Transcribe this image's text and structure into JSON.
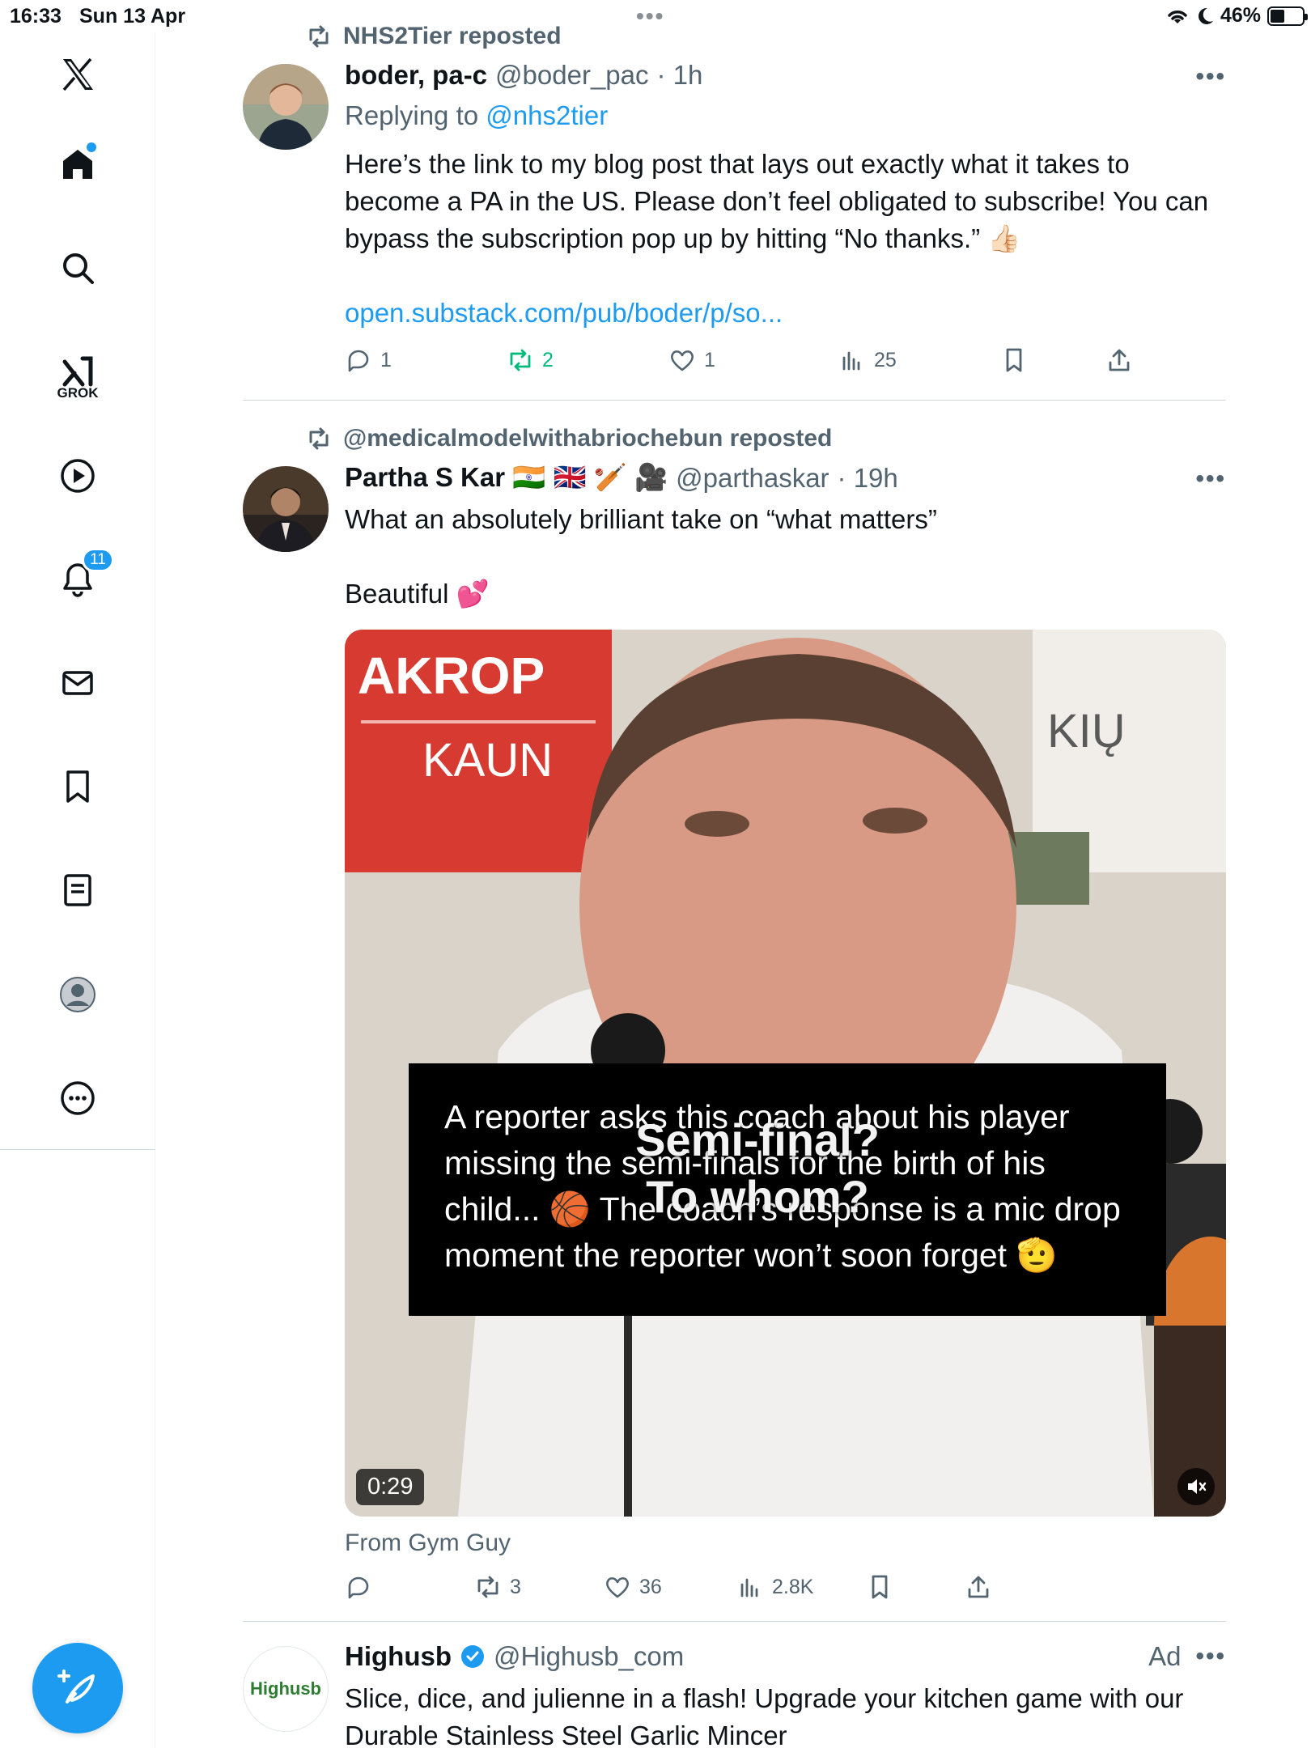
{
  "status_bar": {
    "time": "16:33",
    "date": "Sun 13 Apr",
    "battery": "46%",
    "battery_level": 0.46
  },
  "sidebar": {
    "items": [
      {
        "name": "x-logo",
        "label": ""
      },
      {
        "name": "home",
        "label": ""
      },
      {
        "name": "search",
        "label": ""
      },
      {
        "name": "grok",
        "label": "GROK"
      },
      {
        "name": "video",
        "label": ""
      },
      {
        "name": "notifications",
        "label": "",
        "badge": "11"
      },
      {
        "name": "messages",
        "label": ""
      },
      {
        "name": "bookmarks",
        "label": ""
      },
      {
        "name": "lists",
        "label": ""
      },
      {
        "name": "profile",
        "label": ""
      },
      {
        "name": "more",
        "label": ""
      }
    ],
    "compose_icon": "compose-icon"
  },
  "feed": {
    "tweets": [
      {
        "reposted_by": "NHS2Tier reposted",
        "name": "boder, pa-c",
        "handle": "@boder_pac",
        "time": "· 1h",
        "reply_prefix": "Replying to",
        "reply_to": "@nhs2tier",
        "text": "Here’s the link to my blog post that lays out exactly what it takes to become a PA in the US. Please don’t feel obligated to subscribe! You can  bypass the subscription pop up by hitting “No thanks.” 👍🏻",
        "link": "open.substack.com/pub/boder/p/so...",
        "replies": "1",
        "reposts": "2",
        "likes": "1",
        "views": "25"
      },
      {
        "reposted_by": "@medicalmodelwithabriochebun reposted",
        "name": "Partha S Kar 🇮🇳 🇬🇧 🏏 🎥",
        "handle": "@parthaskar",
        "time": "· 19h",
        "text_line1": "What an absolutely brilliant take on “what matters”",
        "text_line2": "Beautiful 💕",
        "media": {
          "caption": "A reporter asks this coach about his player missing the semi-finals for the birth of his child... 🏀 The coach’s response is a mic drop moment the reporter won’t soon forget 🫡",
          "overlay_line1": "Semi-final?",
          "overlay_line2": "To whom?",
          "duration": "0:29",
          "sign_text_1": "AKROP",
          "sign_text_2": "KAUN",
          "sign_text_3": "KIŲ"
        },
        "source": "From Gym Guy",
        "replies": "",
        "reposts": "3",
        "likes": "36",
        "views": "2.8K"
      },
      {
        "avatar_text": "Highusb",
        "name": "Highusb",
        "handle": "@Highusb_com",
        "ad_label": "Ad",
        "text": "Slice, dice, and julienne in a flash! Upgrade your kitchen game with our Durable Stainless Steel Garlic Mincer"
      }
    ]
  },
  "colors": {
    "accent": "#1d9bf0",
    "repost_green": "#00ba7c",
    "secondary_text": "#536471"
  }
}
